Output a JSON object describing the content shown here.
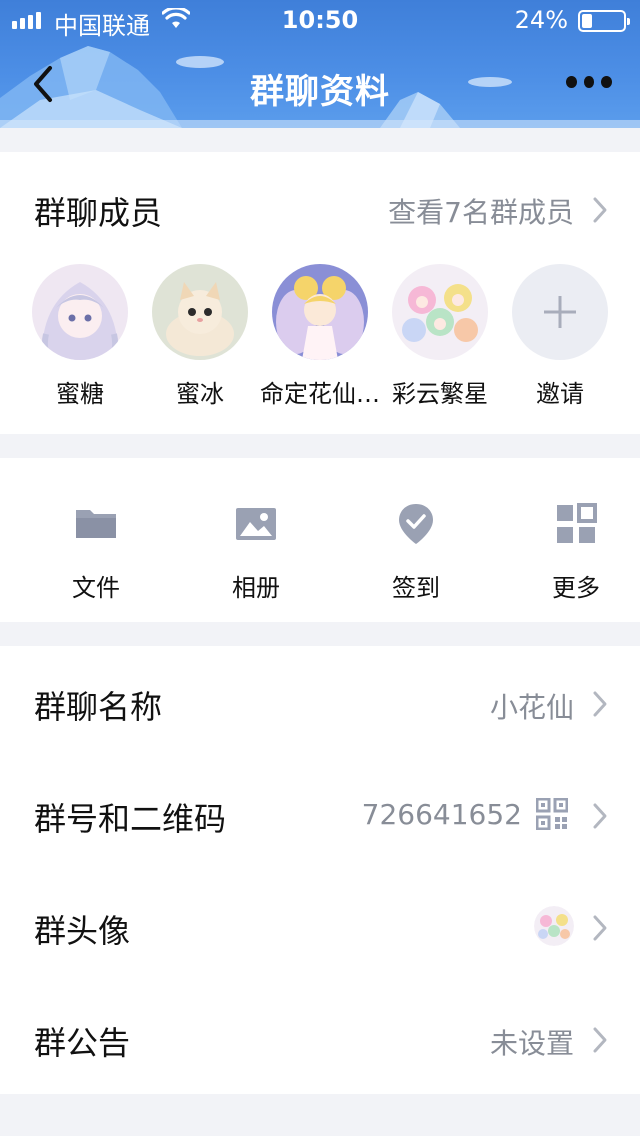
{
  "status_bar": {
    "carrier": "中国联通",
    "time": "10:50",
    "battery": "24%",
    "battery_level": 0.24,
    "icons": [
      "signal-icon",
      "wifi-icon",
      "battery-icon"
    ]
  },
  "nav": {
    "title": "群聊资料",
    "back_icon": "chevron-left-icon",
    "more_icon": "more-horizontal-icon"
  },
  "members_section": {
    "title": "群聊成员",
    "view_all": "查看7名群成员",
    "members": [
      {
        "name": "蜜糖"
      },
      {
        "name": "蜜冰"
      },
      {
        "name": "命定花仙…"
      },
      {
        "name": "彩云繁星"
      }
    ],
    "invite_label": "邀请"
  },
  "tools": [
    {
      "label": "文件",
      "icon": "folder-icon"
    },
    {
      "label": "相册",
      "icon": "image-icon"
    },
    {
      "label": "签到",
      "icon": "location-check-icon"
    },
    {
      "label": "更多",
      "icon": "grid-icon"
    }
  ],
  "info": {
    "name_label": "群聊名称",
    "name_value": "小花仙",
    "number_label": "群号和二维码",
    "number_value": "726641652",
    "avatar_label": "群头像",
    "notice_label": "群公告",
    "notice_value": "未设置"
  },
  "colors": {
    "header": "#4d8fe6",
    "icon_gray": "#9aa1b3",
    "text_secondary": "#888d97",
    "page_bg": "#f2f3f7"
  }
}
